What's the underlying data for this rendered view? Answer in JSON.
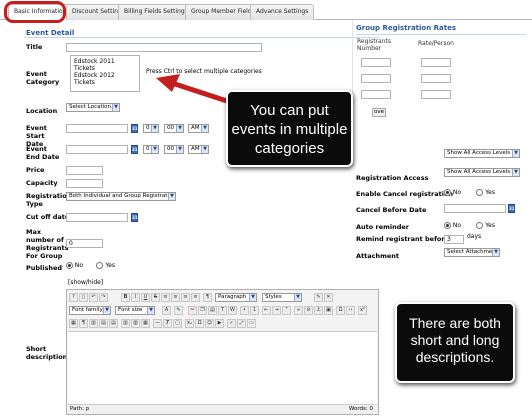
{
  "tabs": [
    {
      "label": "Basic Information",
      "active": true
    },
    {
      "label": "Discount Setting",
      "active": false
    },
    {
      "label": "Billing Fields Setting",
      "active": false
    },
    {
      "label": "Group Member Fields",
      "active": false
    },
    {
      "label": "Advance Settings",
      "active": false
    }
  ],
  "event_detail": {
    "title": "Event Detail",
    "title_label": "Title",
    "category_label": "Event Category",
    "category_options": [
      "Edstock 2011 Tickets",
      "Edstock 2012 Tickets"
    ],
    "category_hint": "Press Ctrl to select multiple categories",
    "location_label": "Location",
    "location_value": "Select Location",
    "start_label": "Event Start Date",
    "end_label": "Event End Date",
    "hour_value": "0",
    "minute_value": "00",
    "ampm_value": "AM",
    "price_label": "Price",
    "capacity_label": "Capacity",
    "reg_type_label": "Registration Type",
    "reg_type_value": "Both Individual and Group Registration",
    "cutoff_label": "Cut off date",
    "max_label": "Max number of Registrants For Group",
    "max_value": "0",
    "published_label": "Published",
    "no_label": "No",
    "yes_label": "Yes",
    "show_hide": "[show/hide]",
    "short_desc_label": "Short description"
  },
  "editor": {
    "paragraph": "Paragraph",
    "styles": "Styles",
    "font_family": "Font family",
    "font_size": "Font size",
    "path": "Path: p",
    "words": "Words: 0"
  },
  "group_rates": {
    "title": "Group Registration Rates",
    "col_registrants": "Registrants Number",
    "col_rate": "Rate/Person",
    "remove_label": "ove"
  },
  "right_settings": {
    "access1_value": "Show All Access Levels",
    "reg_access_label": "Registration Access",
    "access2_value": "Show All Access Levels",
    "cancel_label": "Enable Cancel registration",
    "no_label": "No",
    "yes_label": "Yes",
    "cancel_before_label": "Cancel Before Date",
    "auto_label": "Auto reminder",
    "remind_label": "Remind registrant before",
    "remind_value": "3",
    "days_label": "days",
    "attach_label": "Attachment",
    "attach_value": "Select Attachment"
  },
  "callouts": {
    "categories": "You can put events in multiple categories",
    "descriptions": "There are both short and long descriptions."
  },
  "colors": {
    "highlight": "#c31f1f",
    "section_title": "#2a5a9c",
    "callout_bg": "#0b0b0b"
  }
}
